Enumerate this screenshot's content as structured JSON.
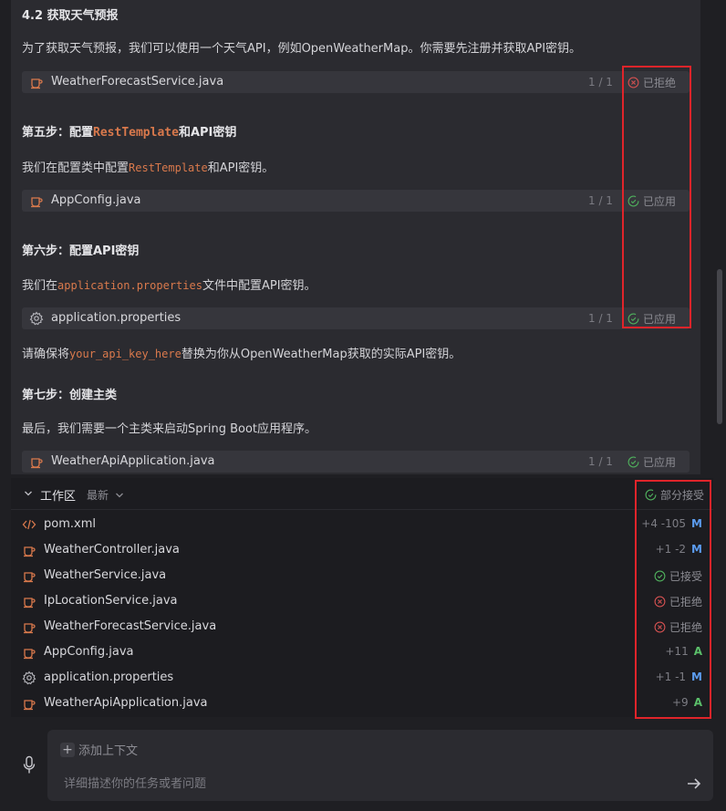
{
  "chat": {
    "section_title": "4.2 获取天气预报",
    "para1": "为了获取天气预报，我们可以使用一个天气API，例如OpenWeatherMap。你需要先注册并获取API密钥。",
    "step5_prefix": "第五步：配置",
    "step5_code": "RestTemplate",
    "step5_suffix": "和API密钥",
    "para2_prefix": "我们在配置类中配置",
    "para2_code": "RestTemplate",
    "para2_suffix": "和API密钥。",
    "step6": "第六步：配置API密钥",
    "para3_prefix": "我们在",
    "para3_code": "application.properties",
    "para3_suffix": "文件中配置API密钥。",
    "para4_prefix": "请确保将",
    "para4_code": "your_api_key_here",
    "para4_suffix": "替换为你从OpenWeatherMap获取的实际API密钥。",
    "step7": "第七步：创建主类",
    "para5": "最后，我们需要一个主类来启动Spring Boot应用程序。",
    "file_cards": [
      {
        "name": "WeatherForecastService.java",
        "count": "1 / 1",
        "status": "已拒绝",
        "icon": "java-cup-icon",
        "state": "rejected"
      },
      {
        "name": "AppConfig.java",
        "count": "1 / 1",
        "status": "已应用",
        "icon": "java-cup-icon",
        "state": "applied"
      },
      {
        "name": "application.properties",
        "count": "1 / 1",
        "status": "已应用",
        "icon": "gear-icon",
        "state": "applied"
      },
      {
        "name": "WeatherApiApplication.java",
        "count": "1 / 1",
        "status": "已应用",
        "icon": "java-cup-icon",
        "state": "applied"
      }
    ]
  },
  "workspace": {
    "title": "工作区",
    "sort_label": "最新",
    "status": "部分接受",
    "files": [
      {
        "name": "pom.xml",
        "icon": "code-icon",
        "stat": "+4 -105",
        "badge": "M"
      },
      {
        "name": "WeatherController.java",
        "icon": "java-cup-icon",
        "stat": "+1 -2",
        "badge": "M"
      },
      {
        "name": "WeatherService.java",
        "icon": "java-cup-icon",
        "state": "accepted",
        "status": "已接受"
      },
      {
        "name": "IpLocationService.java",
        "icon": "java-cup-icon",
        "state": "rejected",
        "status": "已拒绝"
      },
      {
        "name": "WeatherForecastService.java",
        "icon": "java-cup-icon",
        "state": "rejected",
        "status": "已拒绝"
      },
      {
        "name": "AppConfig.java",
        "icon": "java-cup-icon",
        "stat": "+11",
        "badge": "A"
      },
      {
        "name": "application.properties",
        "icon": "gear-icon",
        "stat": "+1 -1",
        "badge": "M"
      },
      {
        "name": "WeatherApiApplication.java",
        "icon": "java-cup-icon",
        "stat": "+9",
        "badge": "A"
      }
    ]
  },
  "input": {
    "add_context": "添加上下文",
    "placeholder": "详细描述你的任务或者问题"
  },
  "colors": {
    "accent_code": "#d9794c",
    "badge_modified": "#5b9cf0",
    "badge_added": "#5bbf6a",
    "highlight_box": "#e0242a"
  }
}
